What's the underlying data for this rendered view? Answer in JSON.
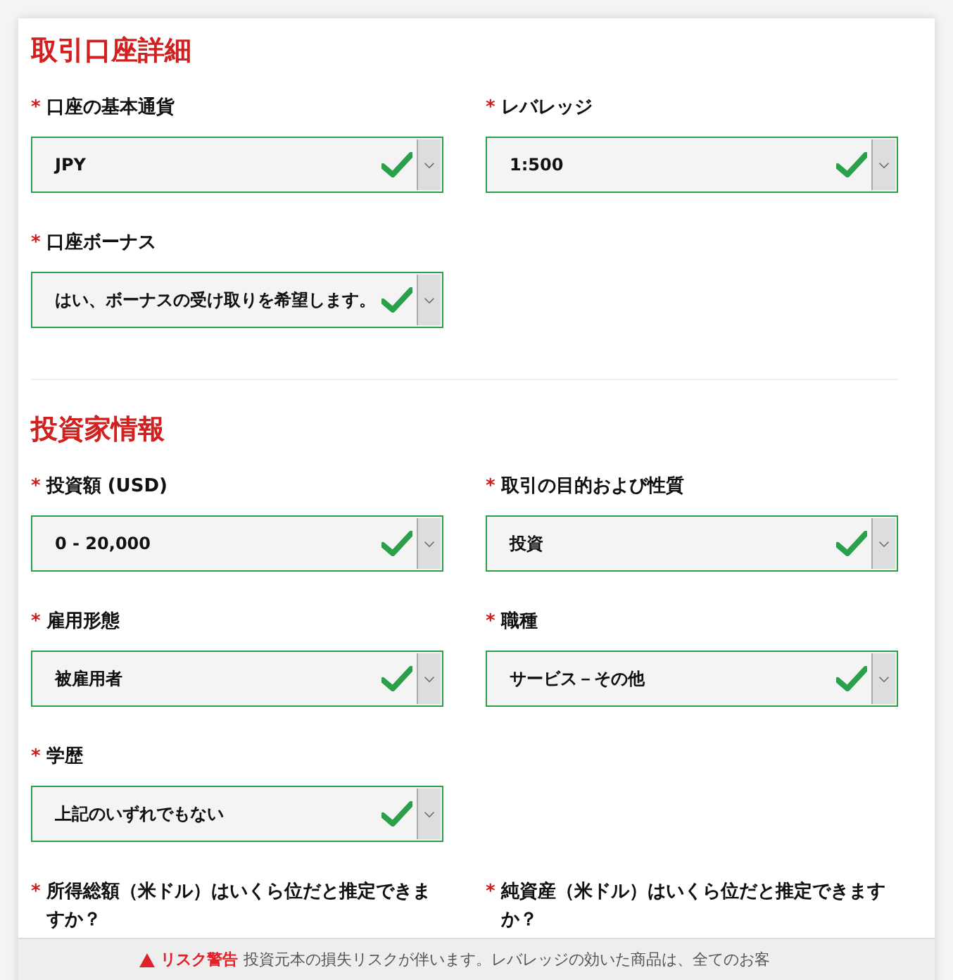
{
  "sections": [
    {
      "title": "取引口座詳細",
      "rows": [
        [
          {
            "mark": "*",
            "label": "口座の基本通貨",
            "value": "JPY",
            "valid": true
          },
          {
            "mark": "*",
            "label": "レバレッジ",
            "value": "1:500",
            "valid": true
          }
        ],
        [
          {
            "mark": "*",
            "label": "口座ボーナス",
            "value": "はい、ボーナスの受け取りを希望します。",
            "valid": true
          }
        ]
      ]
    },
    {
      "title": "投資家情報",
      "rows": [
        [
          {
            "mark": "*",
            "label": "投資額 (USD)",
            "value": "0 - 20,000",
            "valid": true
          },
          {
            "mark": "*",
            "label": "取引の目的および性質",
            "value": "投資",
            "valid": true
          }
        ],
        [
          {
            "mark": "*",
            "label": "雇用形態",
            "value": "被雇用者",
            "valid": true
          },
          {
            "mark": "*",
            "label": "職種",
            "value": "サービス－その他",
            "valid": true
          }
        ],
        [
          {
            "mark": "*",
            "label": "学歴",
            "value": "上記のいずれでもない",
            "valid": true
          }
        ],
        [
          {
            "mark": "*",
            "label": "所得総額（米ドル）はいくら位だと推定できますか？"
          },
          {
            "mark": "*",
            "label": "純資産（米ドル）はいくら位だと推定できますか？"
          }
        ]
      ]
    }
  ],
  "risk_banner": {
    "title": "リスク警告",
    "text": "投資元本の損失リスクが伴います。レバレッジの効いた商品は、全てのお客"
  }
}
